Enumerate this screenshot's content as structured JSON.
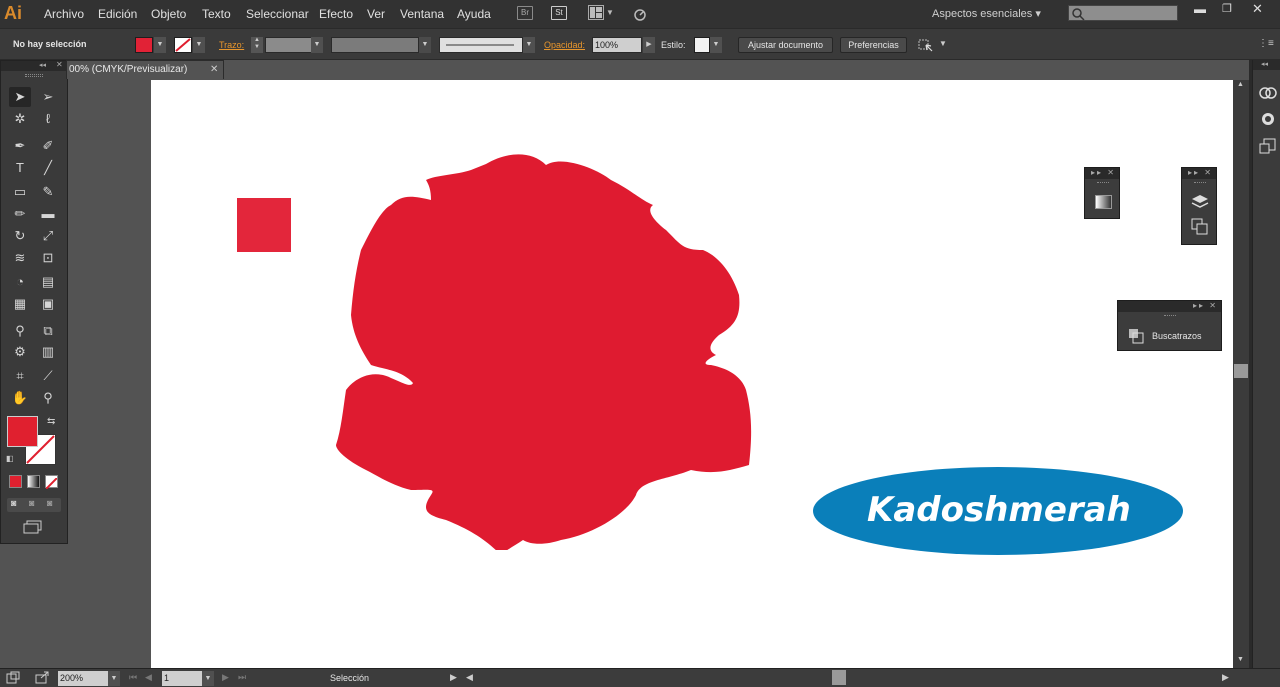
{
  "app": {
    "logo": "Ai"
  },
  "menu": {
    "items": [
      "Archivo",
      "Edición",
      "Objeto",
      "Texto",
      "Seleccionar",
      "Efecto",
      "Ver",
      "Ventana",
      "Ayuda"
    ],
    "bridge_label": "Br",
    "stock_label": "St",
    "workspace": "Aspectos esenciales",
    "workspace_arrow": "▾"
  },
  "control_bar": {
    "selection_status": "No hay selección",
    "fill_color": "#e12236",
    "stroke_label": "Trazo:",
    "opacity_label": "Opacidad:",
    "opacity_value": "100%",
    "style_label": "Estilo:",
    "fit_document_button": "Ajustar documento",
    "preferences_button": "Preferencias"
  },
  "document": {
    "tab_title": "00% (CMYK/Previsualizar)",
    "close_glyph": "✕",
    "logo_text": "Kadoshmerah",
    "logo_color": "#0a7fba",
    "shape_color": "#df1b30",
    "small_square_color": "#e3263b"
  },
  "panels": {
    "pathfinder_label": "Buscatrazos"
  },
  "status_bar": {
    "zoom": "200%",
    "page": "1",
    "tool_name": "Selección"
  },
  "tools": {
    "fill_swatch_color": "#e0202f",
    "icons": [
      "selection-tool-icon",
      "direct-selection-tool-icon",
      "magic-wand-icon",
      "lasso-icon",
      "pen-tool-icon",
      "curvature-tool-icon",
      "type-tool-icon",
      "line-tool-icon",
      "rectangle-tool-icon",
      "paintbrush-icon",
      "pencil-icon",
      "eraser-icon",
      "rotate-icon",
      "scale-icon",
      "warp-icon",
      "free-transform-icon",
      "shape-builder-icon",
      "perspective-grid-icon",
      "mesh-icon",
      "gradient-icon",
      "eyedropper-icon",
      "blend-icon",
      "symbol-sprayer-icon",
      "graph-icon",
      "artboard-tool-icon",
      "slice-icon",
      "hand-icon",
      "zoom-icon"
    ]
  }
}
